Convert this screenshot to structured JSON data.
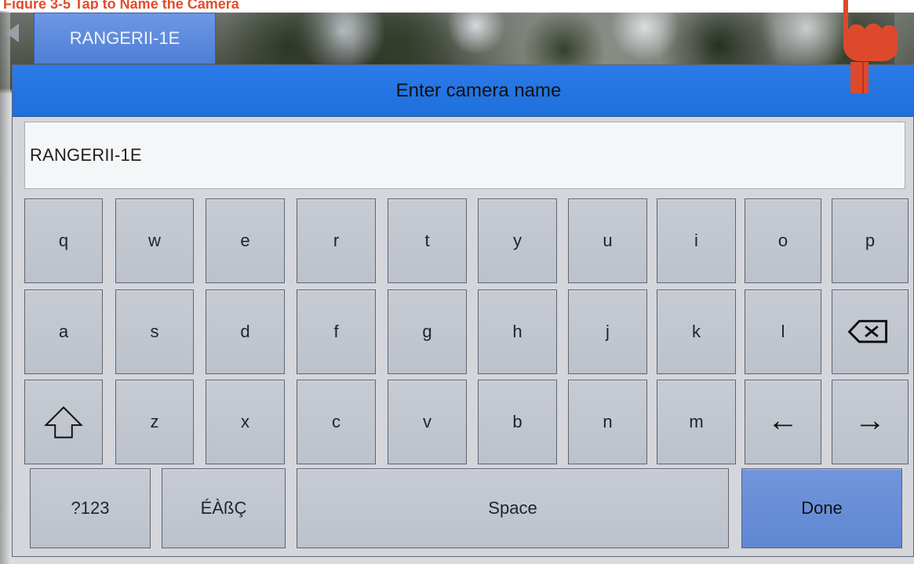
{
  "overlay": {
    "caption": "Figure 3-5 Tap to Name the Camera"
  },
  "camera_tab": {
    "label": "RANGERII-1E"
  },
  "dialog": {
    "title": "Enter camera name",
    "name_value": "RANGERII-1E"
  },
  "keyboard": {
    "row1": [
      "q",
      "w",
      "e",
      "r",
      "t",
      "y",
      "u",
      "i",
      "o",
      "p"
    ],
    "row2": [
      "a",
      "s",
      "d",
      "f",
      "g",
      "h",
      "j",
      "k",
      "l"
    ],
    "row3": [
      "z",
      "x",
      "c",
      "v",
      "b",
      "n",
      "m"
    ],
    "bottom": {
      "numbers": "?123",
      "accents": "ÉÀßÇ",
      "space": "Space",
      "done": "Done"
    },
    "special_icons": {
      "backspace": "backspace-icon",
      "shift": "shift-icon",
      "left": "left-arrow-icon",
      "right": "right-arrow-icon"
    },
    "arrows": {
      "left": "←",
      "right": "→"
    }
  },
  "colors": {
    "accent_blue": "#2b7be9",
    "done_blue": "#6f92d8",
    "annotation_red": "#e54b2a"
  }
}
